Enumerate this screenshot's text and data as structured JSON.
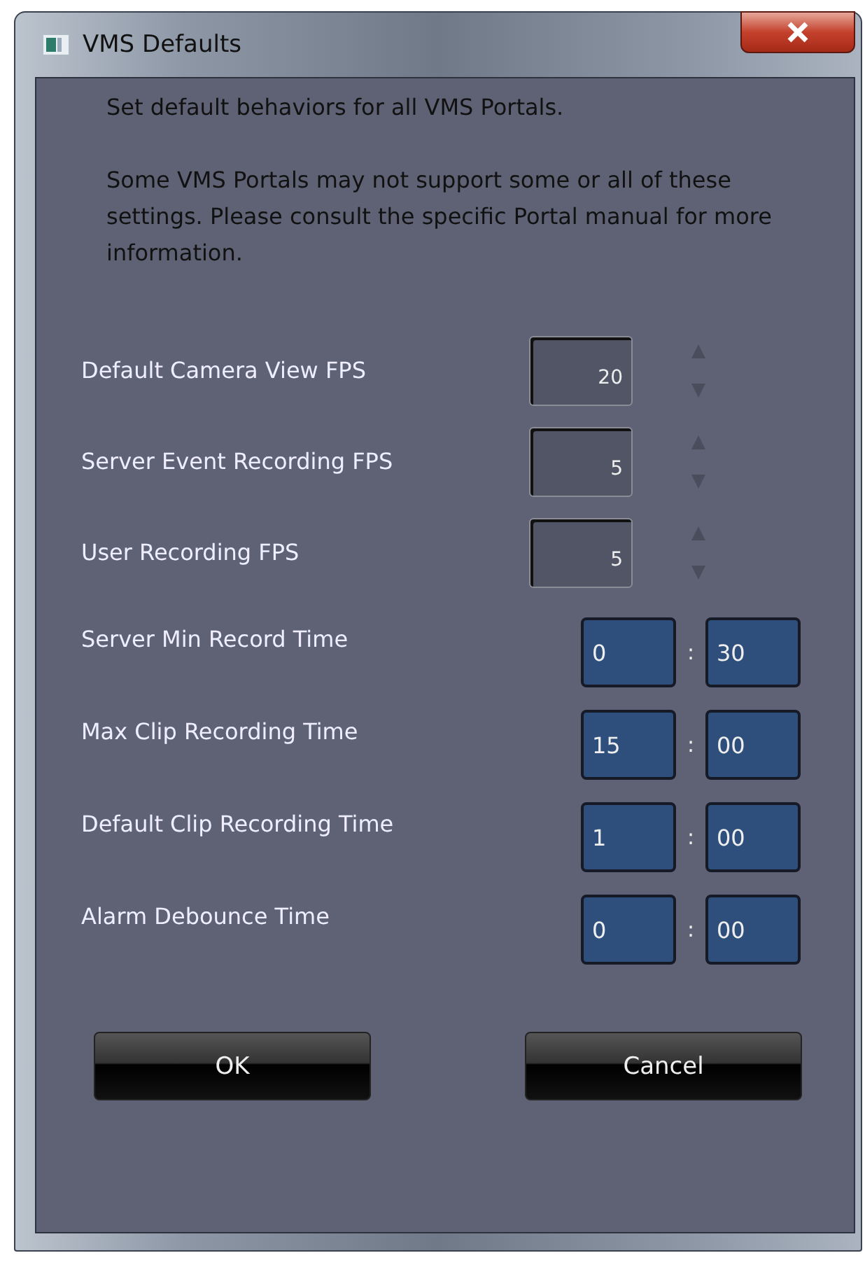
{
  "window": {
    "title": "VMS Defaults"
  },
  "intro": "Set default behaviors for all VMS Portals.",
  "note": "Some VMS Portals may not support some or all of these settings. Please consult the specific Portal manual for more information.",
  "fps_settings": [
    {
      "label": "Default Camera View FPS",
      "value": "20"
    },
    {
      "label": "Server Event Recording FPS",
      "value": "5"
    },
    {
      "label": "User Recording FPS",
      "value": "5"
    }
  ],
  "time_settings": [
    {
      "label": "Server Min Record Time",
      "minutes": "0",
      "separator": ":",
      "seconds": "30"
    },
    {
      "label": "Max Clip Recording Time",
      "minutes": "15",
      "separator": ":",
      "seconds": "00"
    },
    {
      "label": "Default Clip Recording Time",
      "minutes": "1",
      "separator": ":",
      "seconds": "00"
    },
    {
      "label": "Alarm Debounce Time",
      "minutes": "0",
      "separator": ":",
      "seconds": "00"
    }
  ],
  "buttons": [
    "OK",
    "Cancel"
  ]
}
